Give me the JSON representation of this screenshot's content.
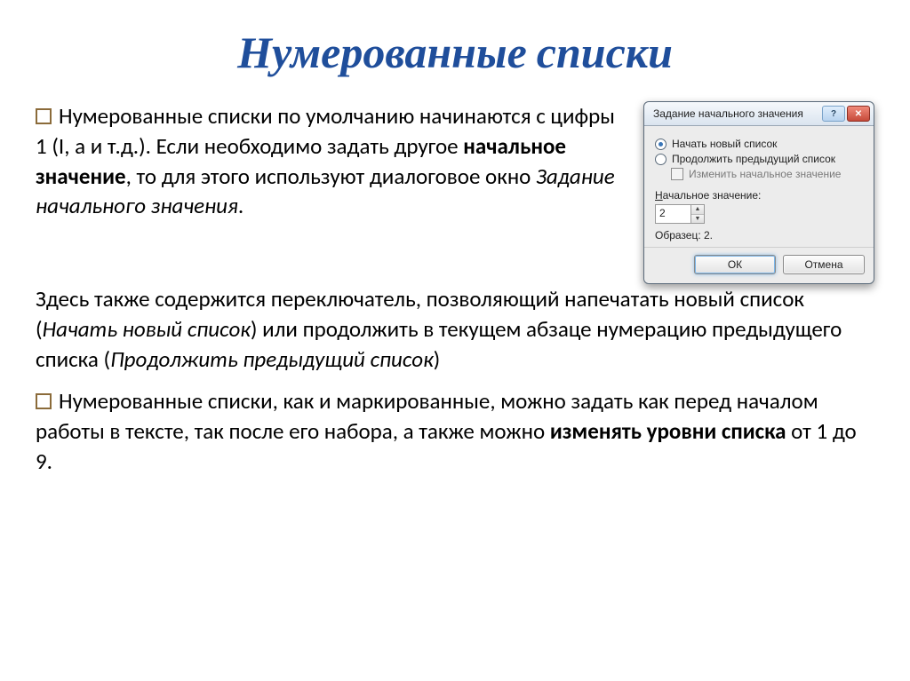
{
  "title": "Нумерованные списки",
  "para1": {
    "lead": "Нумерованные списки по умолчанию начинаются с цифры 1 (I, а и т.д.). Если необходимо задать другое ",
    "bold1": "начальное значение",
    "mid": ", то для этого используют диалоговое окно ",
    "ital1": "Задание начального значения",
    "tail": "."
  },
  "para2": {
    "a": "Здесь  также содержится переключатель, позволяющий напечатать новый список (",
    "i1": "Начать новый список",
    "b": ") или продолжить в текущем абзаце нумерацию предыдущего списка (",
    "i2": "Продолжить предыдущий список",
    "c": ")"
  },
  "para3": {
    "a": "Нумерованные списки, как и маркированные, можно задать как перед началом работы в тексте, так после его набора, а также можно ",
    "bold": "изменять уровни списка",
    "b": " от 1 до 9."
  },
  "dialog": {
    "title": "Задание начального значения",
    "help_glyph": "?",
    "close_glyph": "✕",
    "radio1": "Начать новый список",
    "radio2": "Продолжить предыдущий список",
    "checkbox": "Изменить начальное значение",
    "field_label_pre": "Н",
    "field_label_rest": "ачальное значение:",
    "value": "2",
    "sample_label": "Образец: 2.",
    "ok": "ОК",
    "cancel": "Отмена"
  }
}
